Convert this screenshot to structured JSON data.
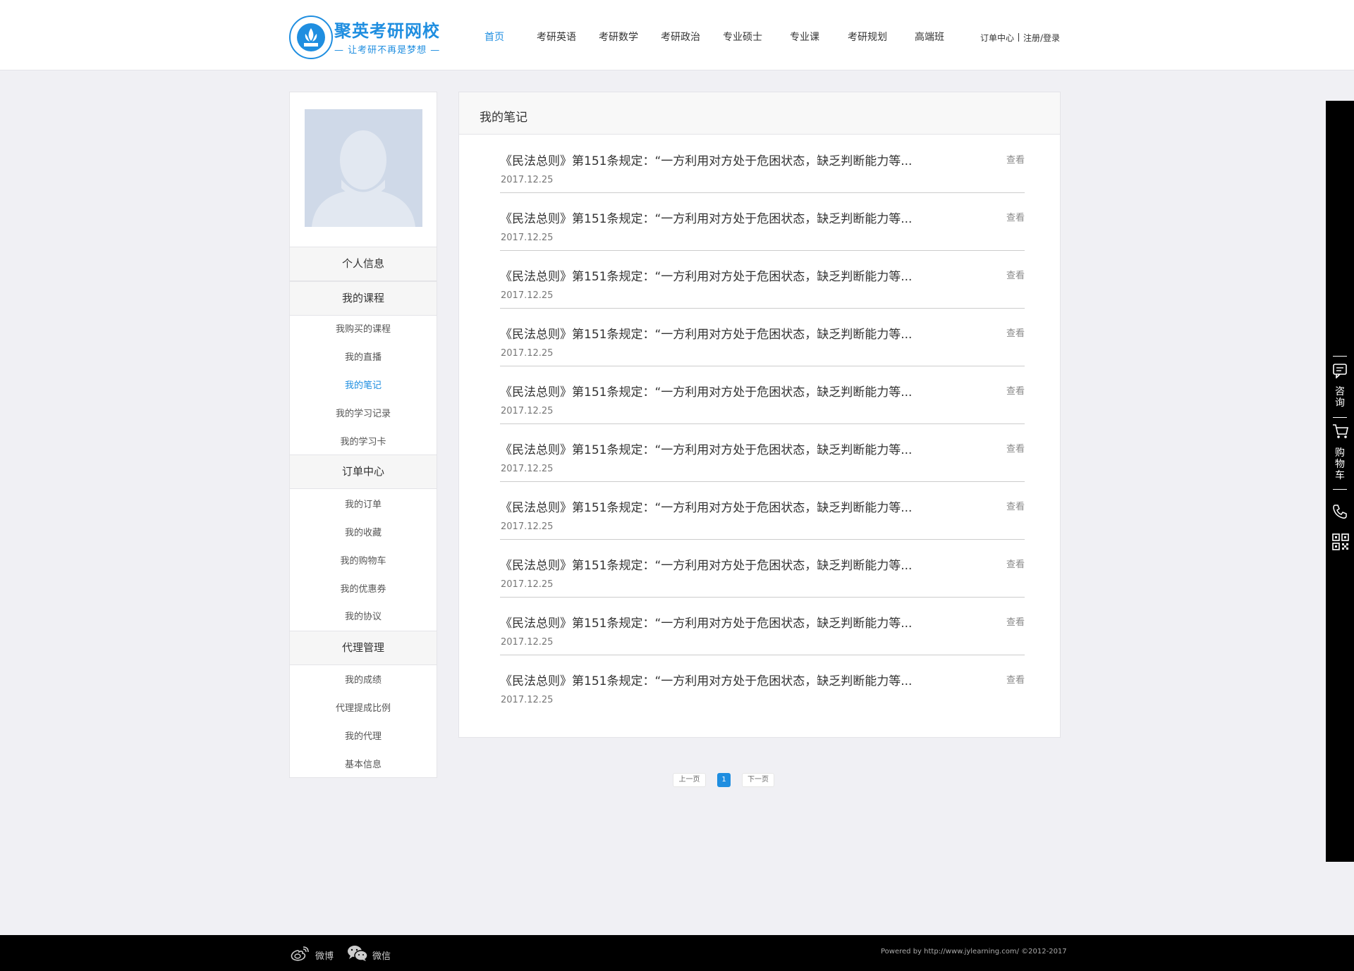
{
  "brand": {
    "name": "聚英考研网校",
    "slogan": "— 让考研不再是梦想 —",
    "accent_color": "#1f8ee0"
  },
  "nav": {
    "items": [
      {
        "label": "首页",
        "active": true
      },
      {
        "label": "考研英语"
      },
      {
        "label": "考研数学"
      },
      {
        "label": "考研政治"
      },
      {
        "label": "专业硕士"
      },
      {
        "label": "专业课"
      },
      {
        "label": "考研规划"
      },
      {
        "label": "高端班"
      }
    ],
    "order_center": "订单中心",
    "login": "注册/登录"
  },
  "sidebar": {
    "avatar_icon": "default-user-avatar",
    "sections": [
      {
        "heading": "个人信息",
        "links": []
      },
      {
        "heading": "我的课程",
        "links": [
          "我购买的课程",
          "我的直播",
          "我的笔记",
          "我的学习记录",
          "我的学习卡"
        ]
      },
      {
        "heading": "订单中心",
        "links": [
          "我的订单",
          "我的收藏",
          "我的购物车",
          "我的优惠券",
          "我的协议"
        ]
      },
      {
        "heading": "代理管理",
        "links": [
          "我的成绩",
          "代理提成比例",
          "我的代理",
          "基本信息"
        ]
      }
    ],
    "active_link": "我的笔记"
  },
  "main": {
    "title": "我的笔记",
    "view_label": "查看",
    "notes": [
      {
        "title": "《民法总则》第151条规定：“一方利用对方处于危困状态，缺乏判断能力等...",
        "date": "2017.12.25"
      },
      {
        "title": "《民法总则》第151条规定：“一方利用对方处于危困状态，缺乏判断能力等...",
        "date": "2017.12.25"
      },
      {
        "title": "《民法总则》第151条规定：“一方利用对方处于危困状态，缺乏判断能力等...",
        "date": "2017.12.25"
      },
      {
        "title": "《民法总则》第151条规定：“一方利用对方处于危困状态，缺乏判断能力等...",
        "date": "2017.12.25"
      },
      {
        "title": "《民法总则》第151条规定：“一方利用对方处于危困状态，缺乏判断能力等...",
        "date": "2017.12.25"
      },
      {
        "title": "《民法总则》第151条规定：“一方利用对方处于危困状态，缺乏判断能力等...",
        "date": "2017.12.25"
      },
      {
        "title": "《民法总则》第151条规定：“一方利用对方处于危困状态，缺乏判断能力等...",
        "date": "2017.12.25"
      },
      {
        "title": "《民法总则》第151条规定：“一方利用对方处于危困状态，缺乏判断能力等...",
        "date": "2017.12.25"
      },
      {
        "title": "《民法总则》第151条规定：“一方利用对方处于危困状态，缺乏判断能力等...",
        "date": "2017.12.25"
      },
      {
        "title": "《民法总则》第151条规定：“一方利用对方处于危困状态，缺乏判断能力等...",
        "date": "2017.12.25"
      }
    ]
  },
  "pagination": {
    "prev": "上一页",
    "current": "1",
    "next": "下一页"
  },
  "toolbar": {
    "consult": "咨询",
    "cart": "购物车",
    "icons": [
      "chat-icon",
      "cart-icon",
      "phone-icon",
      "qrcode-icon"
    ]
  },
  "footer": {
    "weibo": "微博",
    "wechat": "微信",
    "copyright": "Powered by http://www.jylearning.com/ ©2012-2017"
  }
}
